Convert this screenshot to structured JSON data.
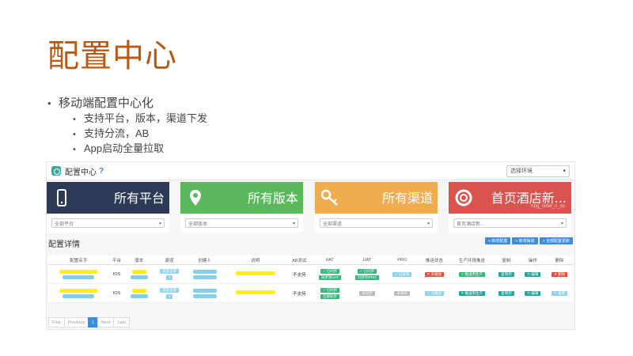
{
  "slide": {
    "title": "配置中心",
    "bullet_main": "移动端配置中心化",
    "sub_bullets": [
      "支持平台，版本，渠道下发",
      "支持分流，AB",
      "App启动全量拉取"
    ]
  },
  "app": {
    "title": "配置中心",
    "help": "?",
    "env_select": "选择环境",
    "tiles": [
      {
        "label": "所有平台",
        "select": "全部平台",
        "color": "#2c3a58",
        "icon": "phone-icon"
      },
      {
        "label": "所有版本",
        "select": "全部版本",
        "color": "#5cb85c",
        "icon": "map-pin-icon"
      },
      {
        "label": "所有渠道",
        "select": "全部渠道",
        "color": "#f0ad4e",
        "icon": "key-icon"
      },
      {
        "label": "首页酒店新...",
        "select": "首页酒店新...",
        "sub": "hpg_hotel_n_os",
        "color": "#d9534f",
        "icon": "lifebuoy-icon"
      }
    ],
    "section_title": "配置详情",
    "actions": [
      "+ 新增配置",
      "+ 新增渠道",
      "+ 全部配置更新"
    ],
    "columns": [
      "配置名字",
      "平台",
      "版本",
      "渠道",
      "创建人",
      "说明",
      "AB测试",
      "FAT",
      "UAT",
      "PRO",
      "推送状态",
      "生产环境推送",
      "复制",
      "操作",
      "删除"
    ],
    "rows": [
      {
        "platform": "IOS",
        "channel": [
          "渠道全部",
          "1"
        ],
        "ab": "不支持",
        "fat": [
          "✓ 已同步",
          "同步到UAT"
        ],
        "uat": [
          "✓ 已同步",
          "同步到PRO"
        ],
        "pro": "✓ 已发布",
        "push": "✕ 未推送",
        "prod_push": "✓ 推送到生产",
        "copy": "复制到",
        "op": "✎ 编辑",
        "delete": "✕ 删除"
      },
      {
        "platform": "IOS",
        "channel": [
          "渠道全部",
          "1"
        ],
        "ab": "不支持",
        "fat": [
          "✓ 已同步",
          "全部同步"
        ],
        "uat": [
          "未同步",
          ""
        ],
        "pro": "未发布",
        "push": "✓ 已推送",
        "prod_push": "✎ 推送到生产",
        "copy": "复制到",
        "op": "✎ 编辑",
        "delete": "✎ 查看"
      }
    ],
    "pager": [
      "First",
      "Previous",
      "1",
      "Next",
      "Last"
    ]
  }
}
